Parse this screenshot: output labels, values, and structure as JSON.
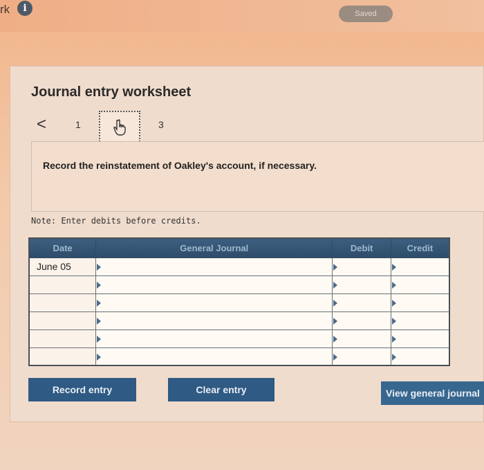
{
  "header": {
    "title_fragment": "rk",
    "info_icon_glyph": "i",
    "saved_label": "Saved"
  },
  "panel": {
    "title": "Journal entry worksheet",
    "nav": {
      "prev_glyph": "<",
      "steps": [
        "1",
        "",
        "3"
      ],
      "current_step_icon": "hand-pointer-icon"
    },
    "instruction": "Record the reinstatement of Oakley's account, if necessary.",
    "note": "Note: Enter debits before credits."
  },
  "journal": {
    "headers": [
      "Date",
      "General Journal",
      "Debit",
      "Credit"
    ],
    "rows": [
      {
        "date": "June 05",
        "account": "",
        "debit": "",
        "credit": ""
      },
      {
        "date": "",
        "account": "",
        "debit": "",
        "credit": ""
      },
      {
        "date": "",
        "account": "",
        "debit": "",
        "credit": ""
      },
      {
        "date": "",
        "account": "",
        "debit": "",
        "credit": ""
      },
      {
        "date": "",
        "account": "",
        "debit": "",
        "credit": ""
      },
      {
        "date": "",
        "account": "",
        "debit": "",
        "credit": ""
      }
    ]
  },
  "buttons": {
    "record": "Record entry",
    "clear": "Clear entry",
    "view": "View general journal"
  },
  "colors": {
    "button_bg": "#2f5a83",
    "header_bg": "#3d5f80",
    "background": "#f1b48a"
  }
}
